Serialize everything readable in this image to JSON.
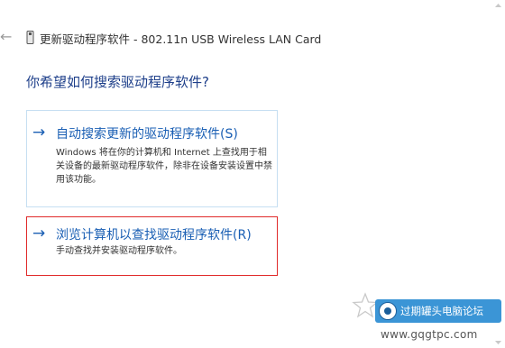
{
  "window": {
    "back_icon": "back-arrow-icon",
    "device_icon": "usb-device-icon",
    "title": "更新驱动程序软件 - 802.11n USB Wireless LAN Card"
  },
  "main": {
    "heading": "你希望如何搜索驱动程序软件?",
    "options": [
      {
        "title": "自动搜索更新的驱动程序软件(S)",
        "description": "Windows 将在你的计算机和 Internet 上查找用于相关设备的最新驱动程序软件，除非在设备安装设置中禁用该功能。"
      },
      {
        "title": "浏览计算机以查找驱动程序软件(R)",
        "description": "手动查找并安装驱动程序软件。"
      }
    ]
  },
  "watermark": {
    "label": "过期罐头电脑论坛",
    "url": "www.gqgtpc.com"
  },
  "colors": {
    "accent": "#1a5fb4",
    "heading": "#1e3f8a",
    "highlight_border": "#e02a2a",
    "option_border": "#c6dff2"
  }
}
